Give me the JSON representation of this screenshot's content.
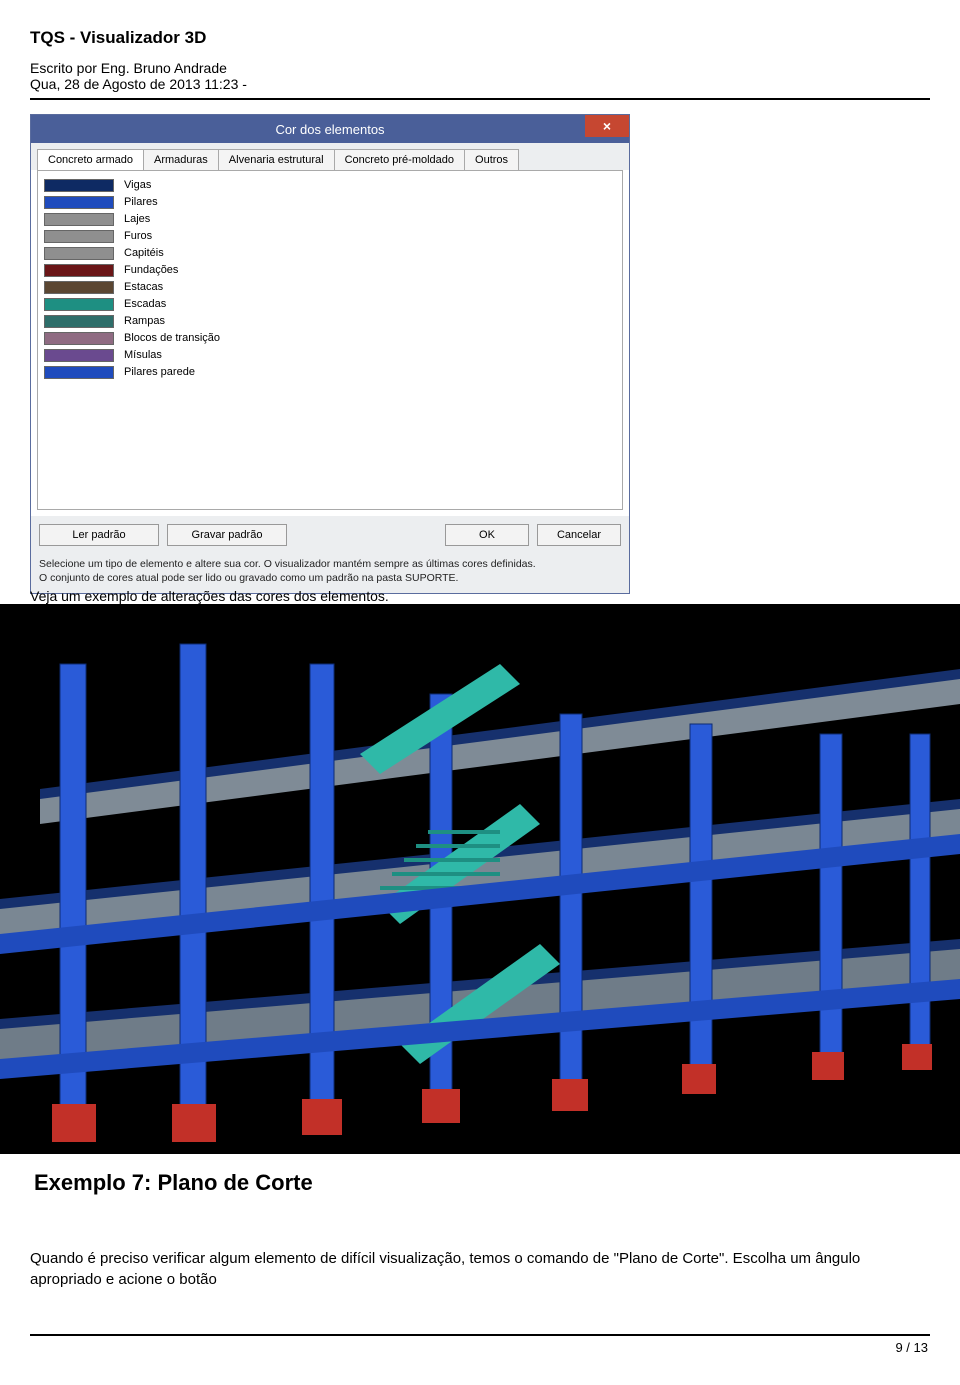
{
  "doc": {
    "title": "TQS - Visualizador 3D",
    "author_line": "Escrito por Eng. Bruno Andrade",
    "date_line": "Qua, 28 de Agosto de 2013 11:23 -",
    "page_num": "9 / 13"
  },
  "dialog": {
    "title": "Cor dos elementos",
    "close_glyph": "×",
    "tabs": [
      {
        "label": "Concreto armado",
        "active": true
      },
      {
        "label": "Armaduras",
        "active": false
      },
      {
        "label": "Alvenaria estrutural",
        "active": false
      },
      {
        "label": "Concreto pré-moldado",
        "active": false
      },
      {
        "label": "Outros",
        "active": false
      }
    ],
    "items": [
      {
        "label": "Vigas",
        "color": "#0e2a63"
      },
      {
        "label": "Pilares",
        "color": "#1f4bbd"
      },
      {
        "label": "Lajes",
        "color": "#8f8f8f"
      },
      {
        "label": "Furos",
        "color": "#8f8f8f"
      },
      {
        "label": "Capitéis",
        "color": "#8f8f8f"
      },
      {
        "label": "Fundações",
        "color": "#6b1618"
      },
      {
        "label": "Estacas",
        "color": "#5b4632"
      },
      {
        "label": "Escadas",
        "color": "#1e8f82"
      },
      {
        "label": "Rampas",
        "color": "#2e6e6a"
      },
      {
        "label": "Blocos de transição",
        "color": "#8f6b82"
      },
      {
        "label": "Mísulas",
        "color": "#6a4a8f"
      },
      {
        "label": "Pilares parede",
        "color": "#1f4bbd"
      }
    ],
    "buttons": {
      "ler": "Ler padrão",
      "gravar": "Gravar padrão",
      "ok": "OK",
      "cancelar": "Cancelar"
    },
    "hint1": "Selecione um tipo de elemento e altere sua cor. O visualizador mantém sempre as últimas cores definidas.",
    "hint2": "O conjunto de cores atual pode ser lido ou gravado como um padrão na pasta SUPORTE."
  },
  "caption_partial": "Veja um exemplo de alterações das cores dos elementos.",
  "section_title": " Exemplo 7: Plano de Corte",
  "body_text": "Quando é preciso verificar algum elemento de difícil visualização, temos o comando de \"Plano de Corte\". Escolha um ângulo apropriado e acione o botão"
}
